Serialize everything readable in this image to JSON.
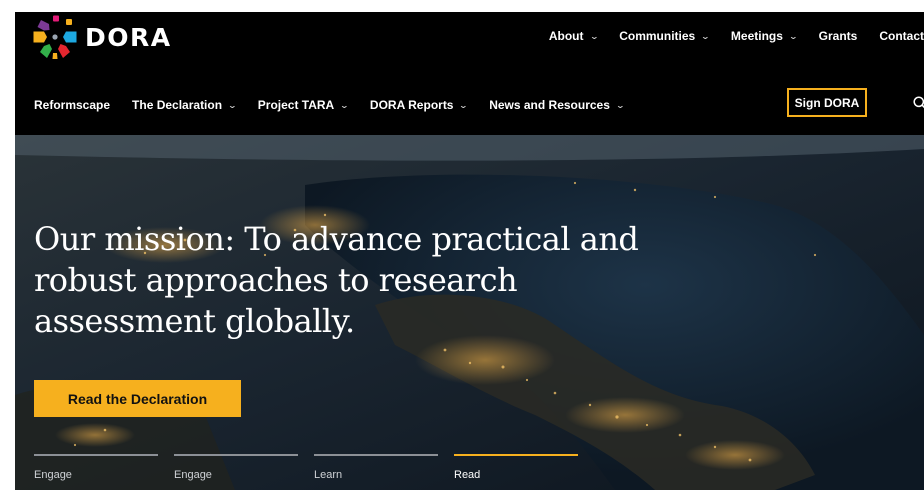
{
  "brand": {
    "name": "DORA"
  },
  "nav_top": [
    {
      "label": "About",
      "dropdown": true
    },
    {
      "label": "Communities",
      "dropdown": true
    },
    {
      "label": "Meetings",
      "dropdown": true
    },
    {
      "label": "Grants",
      "dropdown": false
    },
    {
      "label": "Contact",
      "dropdown": false
    }
  ],
  "nav_main": [
    {
      "label": "Reformscape",
      "dropdown": false
    },
    {
      "label": "The Declaration",
      "dropdown": true
    },
    {
      "label": "Project TARA",
      "dropdown": true
    },
    {
      "label": "DORA Reports",
      "dropdown": true
    },
    {
      "label": "News and Resources",
      "dropdown": true
    }
  ],
  "sign_button": "Sign DORA",
  "hero": {
    "title": "Our mission: To advance practical and robust approaches to research assessment globally.",
    "cta": "Read the Declaration",
    "tabs": [
      {
        "label": "Engage",
        "active": false
      },
      {
        "label": "Engage",
        "active": false
      },
      {
        "label": "Learn",
        "active": false
      },
      {
        "label": "Read",
        "active": true
      }
    ]
  },
  "icons": {
    "search": "search-icon",
    "dropdown": "chevron-down-icon",
    "logo": "dora-logo-icon"
  },
  "colors": {
    "accent": "#f6b01e",
    "header_bg": "#000000",
    "text": "#ffffff"
  }
}
